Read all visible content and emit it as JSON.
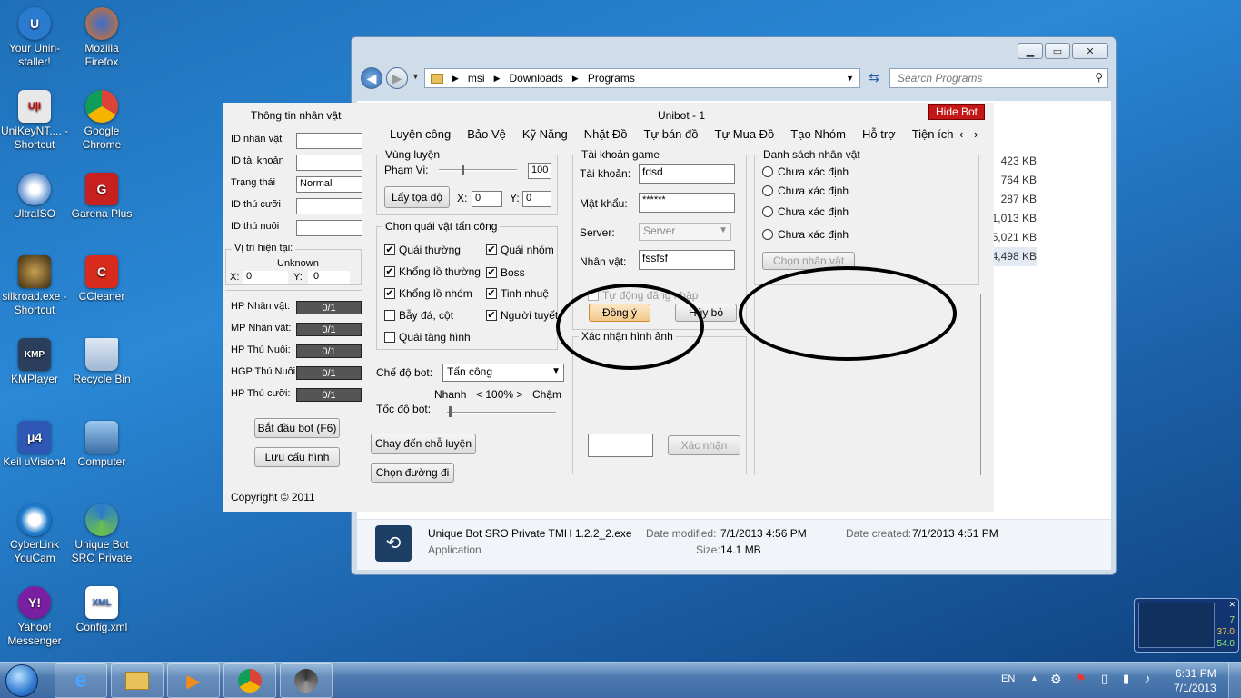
{
  "desktop_icons": [
    {
      "label": "Your Unin-staller!",
      "icon": "uninstaller-icon"
    },
    {
      "label": "Mozilla Firefox",
      "icon": "firefox-icon"
    },
    {
      "label": "UniKeyNT.... - Shortcut",
      "icon": "unikey-icon"
    },
    {
      "label": "Google Chrome",
      "icon": "chrome-icon"
    },
    {
      "label": "UltraISO",
      "icon": "ultraiso-icon"
    },
    {
      "label": "Garena Plus",
      "icon": "garena-icon"
    },
    {
      "label": "silkroad.exe - Shortcut",
      "icon": "silkroad-icon"
    },
    {
      "label": "CCleaner",
      "icon": "ccleaner-icon"
    },
    {
      "label": "KMPlayer",
      "icon": "kmplayer-icon"
    },
    {
      "label": "Recycle Bin",
      "icon": "recycle-bin-icon"
    },
    {
      "label": "Keil uVision4",
      "icon": "keil-icon"
    },
    {
      "label": "Computer",
      "icon": "computer-icon"
    },
    {
      "label": "CyberLink YouCam",
      "icon": "youcam-icon"
    },
    {
      "label": "Unique Bot SRO Private",
      "icon": "uniquebot-icon"
    },
    {
      "label": "Yahoo! Messenger",
      "icon": "yahoo-icon"
    },
    {
      "label": "Config.xml",
      "icon": "xml-file-icon"
    }
  ],
  "explorer": {
    "breadcrumb": [
      "msi",
      "Downloads",
      "Programs"
    ],
    "search_placeholder": "Search Programs",
    "file_sizes": [
      "423 KB",
      "764 KB",
      "287 KB",
      "1,013 KB",
      "5,021 KB",
      "4,498 KB"
    ],
    "details": {
      "name": "Unique Bot SRO Private TMH 1.2.2_2.exe",
      "type": "Application",
      "date_modified_label": "Date modified:",
      "date_modified": "7/1/2013 4:56 PM",
      "size_label": "Size:",
      "size": "14.1 MB",
      "date_created_label": "Date created:",
      "date_created": "7/1/2013 4:51 PM"
    }
  },
  "unibot": {
    "title": "Unibot - 1",
    "hide_bot": "Hide Bot",
    "left_panel": {
      "title": "Thông tin nhân vật",
      "fields": [
        {
          "label": "ID nhân vật",
          "value": ""
        },
        {
          "label": "ID tài khoản",
          "value": ""
        },
        {
          "label": "Trạng thái",
          "value": "Normal"
        },
        {
          "label": "ID thú cưỡi",
          "value": ""
        },
        {
          "label": "ID thú nuôi",
          "value": ""
        }
      ],
      "position_title": "Vị trí hiện tại:",
      "position_status": "Unknown",
      "pos_x_label": "X:",
      "pos_x": "0",
      "pos_y_label": "Y:",
      "pos_y": "0",
      "bars": [
        {
          "label": "HP Nhân vật:",
          "value": "0/1"
        },
        {
          "label": "MP Nhân vật:",
          "value": "0/1"
        },
        {
          "label": "HP Thú Nuôi:",
          "value": "0/1"
        },
        {
          "label": "HGP Thú Nuôi:",
          "value": "0/1"
        },
        {
          "label": "HP Thú cưỡi:",
          "value": "0/1"
        }
      ],
      "start_button": "Bắt đầu bot (F6)",
      "save_button": "Lưu cấu hình",
      "copyright": "Copyright © 2011"
    },
    "tabs": [
      "Luyện công",
      "Bảo Vệ",
      "Kỹ Năng",
      "Nhặt Đồ",
      "Tự bán đồ",
      "Tự Mua Đồ",
      "Tạo Nhóm",
      "Hỗ trợ",
      "Tiện ích"
    ],
    "training": {
      "title": "Vùng luyện",
      "range_label": "Phạm Vi:",
      "range_value": "100",
      "get_coord_button": "Lấy tọa độ",
      "x_label": "X:",
      "x_value": "0",
      "y_label": "Y:",
      "y_value": "0"
    },
    "monsters": {
      "title": "Chọn quái vật tấn công",
      "options": [
        {
          "label": "Quái thường",
          "checked": true
        },
        {
          "label": "Quái nhóm",
          "checked": true
        },
        {
          "label": "Khổng lồ thường",
          "checked": true
        },
        {
          "label": "Boss",
          "checked": true
        },
        {
          "label": "Khổng lồ nhóm",
          "checked": true
        },
        {
          "label": "Tinh nhuệ",
          "checked": true
        },
        {
          "label": "Bẫy đá, cột",
          "checked": false
        },
        {
          "label": "Người tuyết",
          "checked": true
        },
        {
          "label": "Quái tàng hình",
          "checked": false
        }
      ]
    },
    "mode_label": "Chế độ bot:",
    "mode_value": "Tấn công",
    "speed": {
      "fast": "Nhanh",
      "value": "< 100% >",
      "slow": "Chậm",
      "label": "Tốc độ bot:"
    },
    "run_to_training": "Chạy đến chỗ luyện",
    "choose_path": "Chọn đường đi",
    "account": {
      "title": "Tài khoản game",
      "username_label": "Tài khoản:",
      "username": "fdsd",
      "password_label": "Mật khẩu:",
      "password": "******",
      "server_label": "Server:",
      "server": "Server",
      "character_label": "Nhân vật:",
      "character": "fssfsf",
      "auto_login": "Tự động đăng nhập",
      "ok_button": "Đồng ý",
      "cancel_button": "Hủy bỏ"
    },
    "captcha": {
      "title": "Xác nhận hình ảnh",
      "confirm_button": "Xác nhận"
    },
    "characters": {
      "title": "Danh sách nhân vật",
      "options": [
        "Chưa xác định",
        "Chưa xác định",
        "Chưa xác định",
        "Chưa xác định"
      ],
      "choose_button": "Chọn nhân vật"
    }
  },
  "gadget": {
    "values": [
      "7",
      "37.0",
      "54.0"
    ]
  },
  "taskbar": {
    "language": "EN",
    "time": "6:31 PM",
    "date": "7/1/2013"
  }
}
